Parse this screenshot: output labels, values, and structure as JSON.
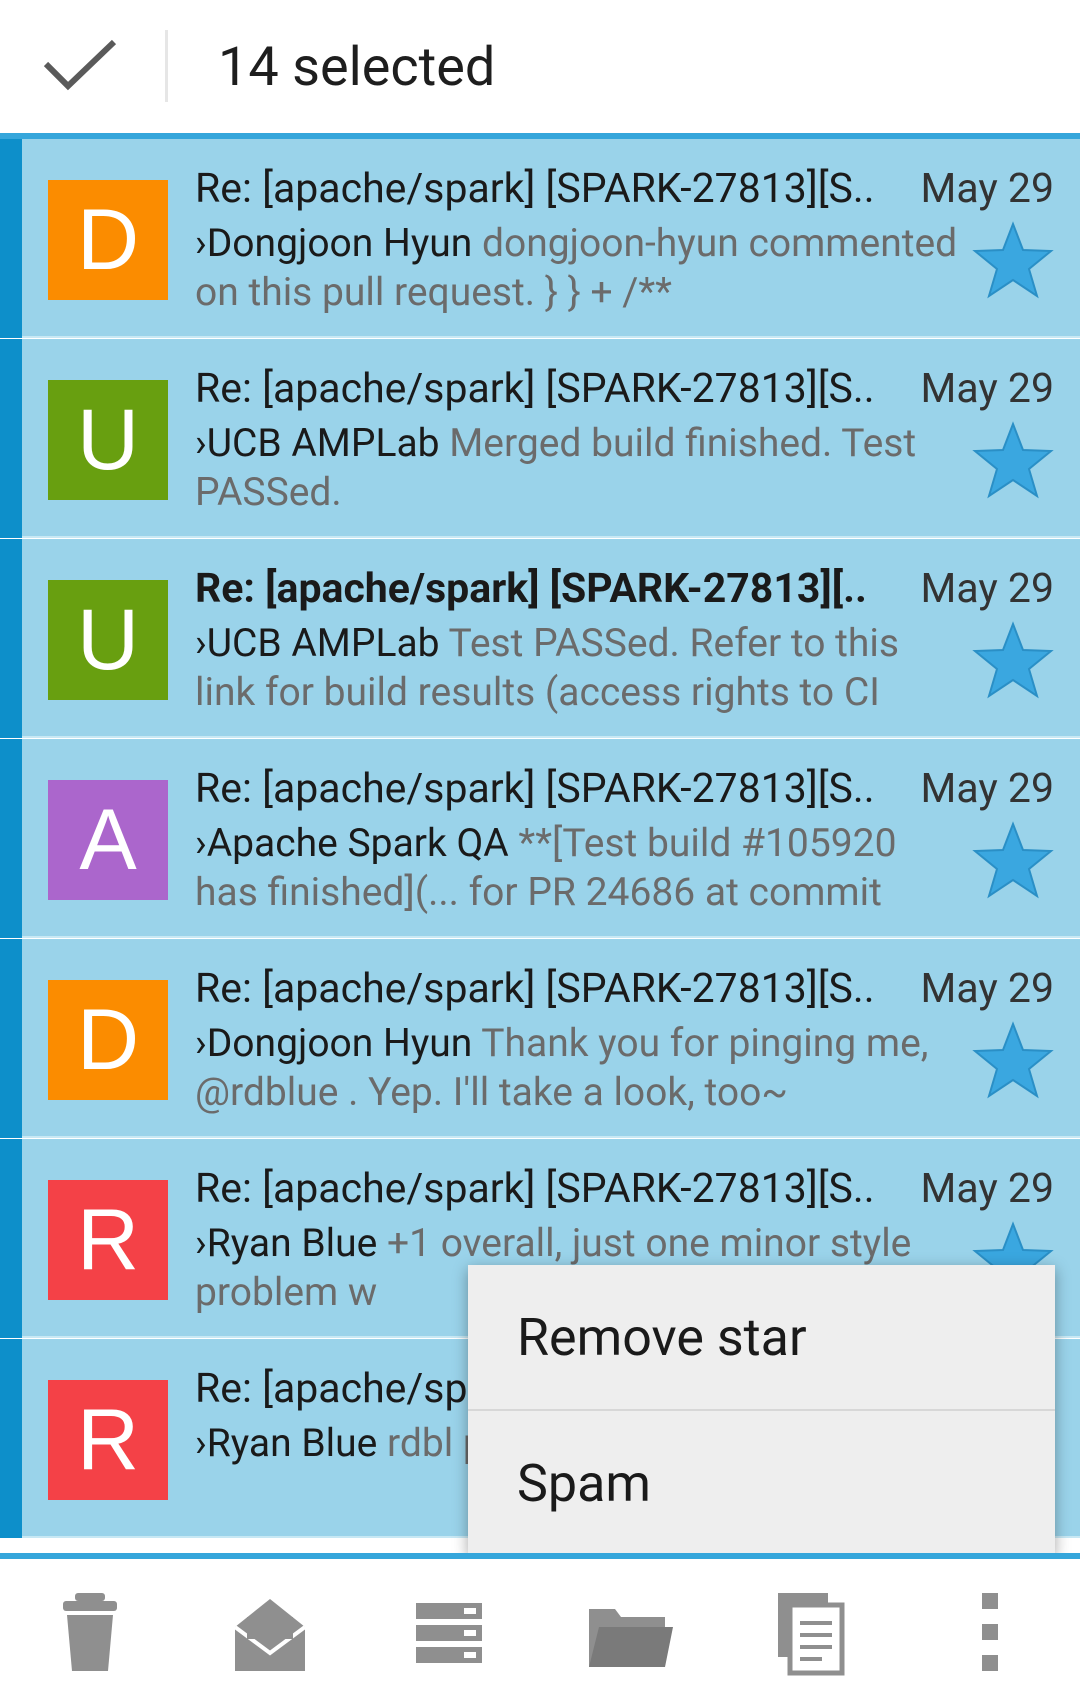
{
  "header": {
    "title": "14 selected"
  },
  "emails": [
    {
      "avatar_letter": "D",
      "avatar_color": "#fb8c00",
      "subject": "Re: [apache/spark] [SPARK-27813][S..",
      "date": "May 29",
      "sender": "›Dongjoon Hyun",
      "preview": " dongjoon-hyun commented on this pull request. } } + /**",
      "bold": false
    },
    {
      "avatar_letter": "U",
      "avatar_color": "#689f10",
      "subject": "Re: [apache/spark] [SPARK-27813][S..",
      "date": "May 29",
      "sender": "›UCB AMPLab",
      "preview": " Merged build finished. Test PASSed.",
      "bold": false
    },
    {
      "avatar_letter": "U",
      "avatar_color": "#689f10",
      "subject": "Re: [apache/spark] [SPARK-27813][..",
      "date": "May 29",
      "sender": "›UCB AMPLab",
      "preview": " Test PASSed. Refer to this link for build results (access rights to CI",
      "bold": true
    },
    {
      "avatar_letter": "A",
      "avatar_color": "#ab66cc",
      "subject": "Re: [apache/spark] [SPARK-27813][S..",
      "date": "May 29",
      "sender": "›Apache Spark QA",
      "preview": " **[Test build #105920 has finished](... for PR 24686 at commit",
      "bold": false
    },
    {
      "avatar_letter": "D",
      "avatar_color": "#fb8c00",
      "subject": "Re: [apache/spark] [SPARK-27813][S..",
      "date": "May 29",
      "sender": "›Dongjoon Hyun",
      "preview": " Thank you for pinging me, @rdblue . Yep. I'll take a look, too~",
      "bold": false
    },
    {
      "avatar_letter": "R",
      "avatar_color": "#f44147",
      "subject": "Re: [apache/spark] [SPARK-27813][S..",
      "date": "May 29",
      "sender": "›Ryan Blue",
      "preview": " +1 overall, just one minor style problem w",
      "bold": false
    },
    {
      "avatar_letter": "R",
      "avatar_color": "#f44147",
      "subject": "Re: [apache/sp",
      "date": "",
      "sender": "›Ryan Blue",
      "preview": " rdbl pull request. s\"",
      "bold": false
    }
  ],
  "menu": {
    "items": [
      "Remove star",
      "Spam"
    ]
  },
  "bottom_bar": {
    "icons": [
      "trash-icon",
      "mark-read-icon",
      "archive-icon",
      "folder-icon",
      "copy-icon",
      "more-icon"
    ]
  },
  "colors": {
    "accent": "#35a6db",
    "selected_row": "#9ad3ea",
    "selection_bar": "#0d8fca",
    "star": "#3aa7e0"
  }
}
